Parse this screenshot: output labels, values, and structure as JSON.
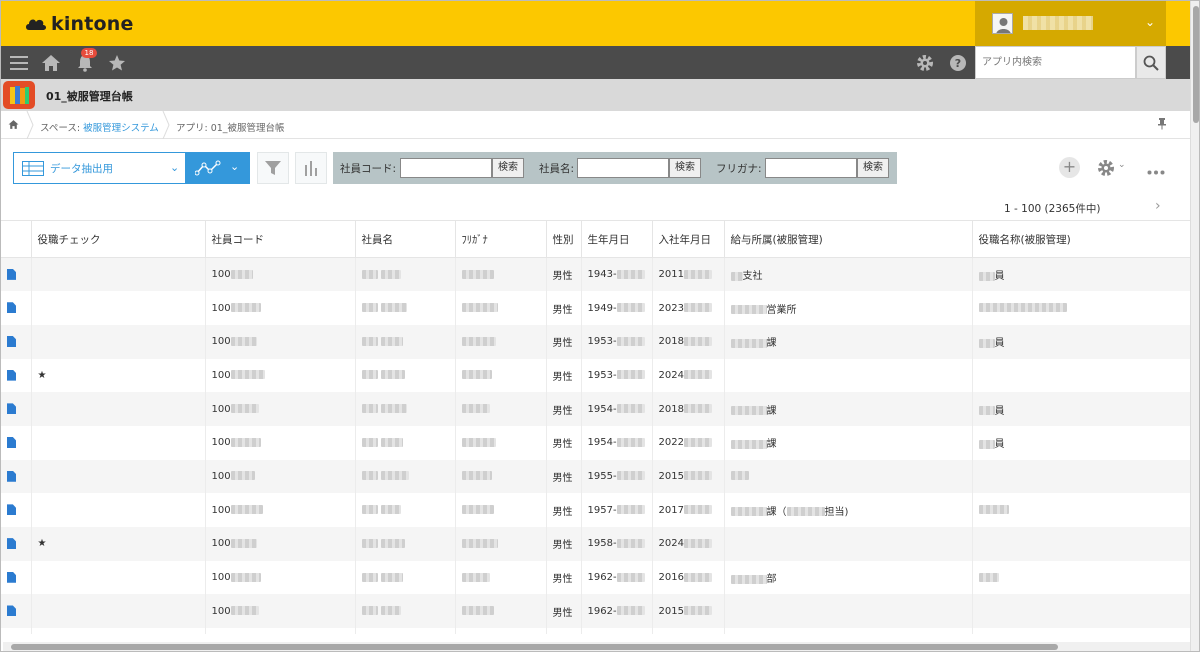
{
  "header": {
    "logo_text": "kintone",
    "notification_count": "18"
  },
  "search": {
    "placeholder": "アプリ内検索"
  },
  "app": {
    "title": "01_被服管理台帳"
  },
  "breadcrumb": {
    "space_label": "スペース:",
    "space_name": "被服管理システム",
    "app_label": "アプリ: 01_被服管理台帳"
  },
  "toolbar": {
    "view_name": "データ抽出用"
  },
  "filters": [
    {
      "label": "社員コード:",
      "button": "検索"
    },
    {
      "label": "社員名:",
      "button": "検索"
    },
    {
      "label": "フリガナ:",
      "button": "検索"
    }
  ],
  "pager": {
    "text": "1 - 100  (2365件中)"
  },
  "table": {
    "columns": [
      "役職チェック",
      "社員コード",
      "社員名",
      "ﾌﾘｶﾞﾅ",
      "性別",
      "生年月日",
      "入社年月日",
      "給与所属(被服管理)",
      "役職名称(被服管理)"
    ],
    "rows": [
      {
        "check": "",
        "code": "100",
        "gender": "男性",
        "birth": "1943-",
        "join": "2011",
        "dept": "支社",
        "title": "員"
      },
      {
        "check": "",
        "code": "100",
        "gender": "男性",
        "birth": "1949-",
        "join": "2023",
        "dept": "営業所",
        "title": ""
      },
      {
        "check": "",
        "code": "100",
        "gender": "男性",
        "birth": "1953-",
        "join": "2018",
        "dept": "課",
        "title": "員"
      },
      {
        "check": "★",
        "code": "100",
        "gender": "男性",
        "birth": "1953-",
        "join": "2024",
        "dept": "",
        "title": ""
      },
      {
        "check": "",
        "code": "100",
        "gender": "男性",
        "birth": "1954-",
        "join": "2018",
        "dept": "課",
        "title": "員"
      },
      {
        "check": "",
        "code": "100",
        "gender": "男性",
        "birth": "1954-",
        "join": "2022",
        "dept": "課",
        "title": "員"
      },
      {
        "check": "",
        "code": "100",
        "gender": "男性",
        "birth": "1955-",
        "join": "2015",
        "dept": "",
        "title": ""
      },
      {
        "check": "",
        "code": "100",
        "gender": "男性",
        "birth": "1957-",
        "join": "2017",
        "dept": "課（",
        "dept2": "担当)",
        "title": ""
      },
      {
        "check": "★",
        "code": "100",
        "gender": "男性",
        "birth": "1958-",
        "join": "2024",
        "dept": "",
        "title": ""
      },
      {
        "check": "",
        "code": "100",
        "gender": "男性",
        "birth": "1962-",
        "join": "2016",
        "dept": "部",
        "title": ""
      },
      {
        "check": "",
        "code": "100",
        "gender": "男性",
        "birth": "1962-",
        "join": "2015",
        "dept": "",
        "title": ""
      }
    ]
  },
  "colors": {
    "header_yellow": "#fcc800",
    "nav_gray": "#4b4b4b",
    "accent_blue": "#3498db",
    "filter_panel": "#b7c4c6"
  },
  "icons": [
    "menu-icon",
    "home-icon",
    "bell-icon",
    "star-icon",
    "gear-icon",
    "help-icon",
    "search-icon",
    "user-icon",
    "doc-icon",
    "filter-icon",
    "chart-icon",
    "graph-icon",
    "plus-icon",
    "more-icon",
    "pin-icon"
  ]
}
